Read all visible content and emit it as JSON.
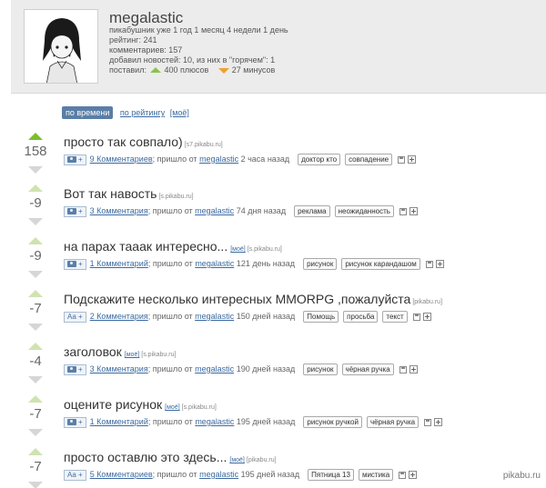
{
  "profile": {
    "username": "megalastic",
    "lines": [
      "пикабушник уже 1 год 1 месяц 4 недели 1 день",
      "рейтинг: 241",
      "комментариев: 157",
      "добавил новостей: 10, из них в \"горячем\": 1"
    ],
    "votes_prefix": "поставил:",
    "plus_text": "400 плюсов",
    "minus_text": "27 минусов"
  },
  "sort": {
    "active": "по времени",
    "by_rating": "по рейтингу",
    "mine": "[моё]"
  },
  "posts": [
    {
      "score": "158",
      "title": "просто так совпало)",
      "moe": "",
      "src": "[s7.pikabu.ru]",
      "media": "camera",
      "media_label": "+",
      "comments": "9 Комментариев",
      "came_from": "; пришло от",
      "author": "megalastic",
      "age": "2 часа назад",
      "tags": [
        "доктор кто",
        "совпадение"
      ]
    },
    {
      "score": "-9",
      "title": "Вот так навость",
      "moe": "",
      "src": "[s.pikabu.ru]",
      "media": "camera",
      "media_label": "+",
      "comments": "3 Комментария",
      "came_from": "; пришло от",
      "author": "megalastic",
      "age": "74 дня назад",
      "tags": [
        "реклама",
        "неожиданность"
      ]
    },
    {
      "score": "-9",
      "title": "на парах тааак интересно...",
      "moe": "[моё]",
      "src": "[s.pikabu.ru]",
      "media": "camera",
      "media_label": "+",
      "comments": "1 Комментарий",
      "came_from": "; пришло от",
      "author": "megalastic",
      "age": "121 день назад",
      "tags": [
        "рисунок",
        "рисунок карандашом"
      ]
    },
    {
      "score": "-7",
      "title": "Подскажите несколько интересных MMORPG ,пожалуйста",
      "moe": "",
      "src": "[pikabu.ru]",
      "media": "text",
      "media_label": "Aa +",
      "comments": "2 Комментария",
      "came_from": "; пришло от",
      "author": "megalastic",
      "age": "150 дней назад",
      "tags": [
        "Помощь",
        "просьба",
        "текст"
      ]
    },
    {
      "score": "-4",
      "title": "заголовок",
      "moe": "[моё]",
      "src": "[s.pikabu.ru]",
      "media": "camera",
      "media_label": "+",
      "comments": "3 Комментария",
      "came_from": "; пришло от",
      "author": "megalastic",
      "age": "190 дней назад",
      "tags": [
        "рисунок",
        "чёрная ручка"
      ]
    },
    {
      "score": "-7",
      "title": "оцените рисунок",
      "moe": "[моё]",
      "src": "[s.pikabu.ru]",
      "media": "camera",
      "media_label": "+",
      "comments": "1 Комментарий",
      "came_from": "; пришло от",
      "author": "megalastic",
      "age": "195 дней назад",
      "tags": [
        "рисунок ручкой",
        "чёрная ручка"
      ]
    },
    {
      "score": "-7",
      "title": "просто оставлю это здесь...",
      "moe": "[моё]",
      "src": "[pikabu.ru]",
      "media": "text",
      "media_label": "Aa +",
      "comments": "5 Комментариев",
      "came_from": "; пришло от",
      "author": "megalastic",
      "age": "195 дней назад",
      "tags": [
        "Пятница 13",
        "мистика"
      ]
    }
  ],
  "watermark": "pikabu.ru",
  "colors": {
    "accent": "#5a7ea6",
    "link": "#3b6aa0",
    "upvote": "#7bbf2a",
    "downvote_marker": "#f0a030"
  }
}
